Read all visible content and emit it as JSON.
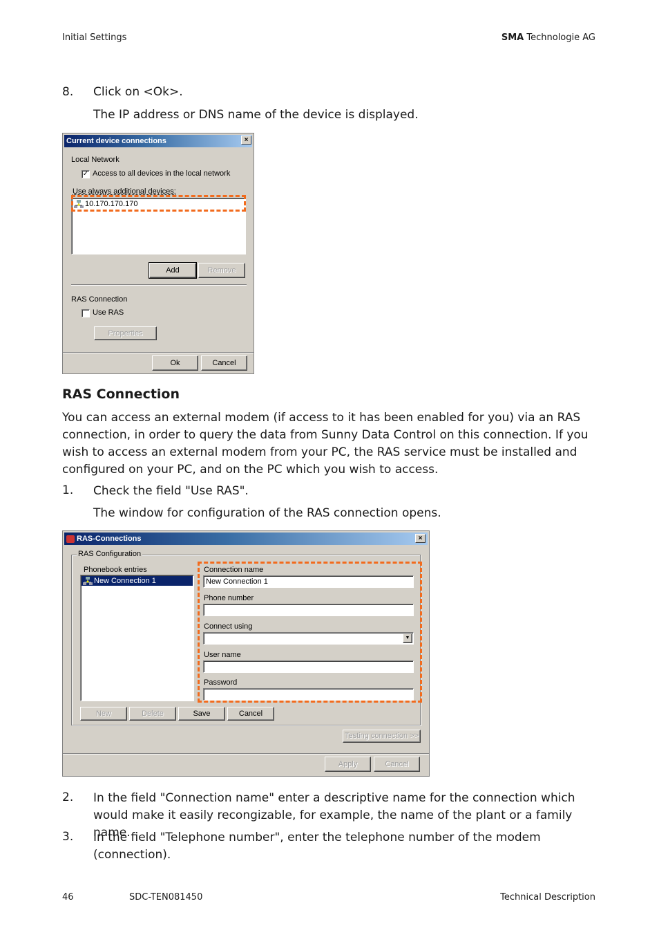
{
  "header": {
    "section": "Initial Settings",
    "company_bold": "SMA",
    "company_rest": " Technologie AG"
  },
  "steps_top": [
    {
      "num": "8.",
      "text": "Click on <Ok>.",
      "result": "The IP address or DNS name of the device is displayed."
    }
  ],
  "dialog1": {
    "title": "Current device connections",
    "close": "×",
    "local_network_label": "Local Network",
    "access_all_checkbox": {
      "label": "Access to all devices in the local network",
      "checked": true,
      "mark": "✓"
    },
    "additional_label": "Use always additional devices:",
    "devices": [
      "10.170.170.170"
    ],
    "add_button": "Add",
    "remove_button": "Remove",
    "ras_label": "RAS Connection",
    "use_ras_checkbox": {
      "label": "Use RAS",
      "checked": false
    },
    "properties_button": "Properties",
    "ok_button": "Ok",
    "cancel_button": "Cancel"
  },
  "section": {
    "title": "RAS Connection",
    "paragraph": "You can access an external modem (if access to it has been enabled for you) via an RAS connection, in order to query the data from Sunny Data Control on this connection. If you wish to access an external modem from your PC, the RAS service must be installed and configured on your PC, and on the PC which you wish to access."
  },
  "steps_mid": [
    {
      "num": "1.",
      "text": "Check the field \"Use RAS\".",
      "result": "The window for configuration of the RAS connection opens."
    }
  ],
  "dialog2": {
    "title": "RAS-Connections",
    "close": "×",
    "group_label": "RAS Configuration",
    "phonebook_label": "Phonebook entries",
    "phonebook_entries": [
      "New Connection 1"
    ],
    "fields": {
      "connection_name": {
        "label": "Connection name",
        "value": "New Connection 1"
      },
      "phone_number": {
        "label": "Phone number",
        "value": ""
      },
      "connect_using": {
        "label": "Connect using",
        "value": ""
      },
      "user_name": {
        "label": "User name",
        "value": ""
      },
      "password": {
        "label": "Password",
        "value": ""
      }
    },
    "new_button": "New",
    "delete_button": "Delete",
    "save_button": "Save",
    "cancel_button": "Cancel",
    "testing_button": "Testing connection >>",
    "apply_button": "Apply",
    "cancel2_button": "Cancel",
    "dropdown_arrow": "▼"
  },
  "steps_bottom": [
    {
      "num": "2.",
      "text": "In the field \"Connection name\" enter a descriptive name for the connection which would make it easily recongizable, for example, the name of the plant or a family name."
    },
    {
      "num": "3.",
      "text": "In the field \"Telephone number\", enter the telephone number of the modem (connection)."
    }
  ],
  "footer": {
    "page": "46",
    "doc_id": "SDC-TEN081450",
    "doc_type": "Technical Description"
  },
  "colors": {
    "highlight_dash": "#f26b1d",
    "title_gradient_start": "#0a246a",
    "title_gradient_end": "#a6caf0",
    "dialog_bg": "#d4d0c8",
    "selection": "#0a246a"
  }
}
